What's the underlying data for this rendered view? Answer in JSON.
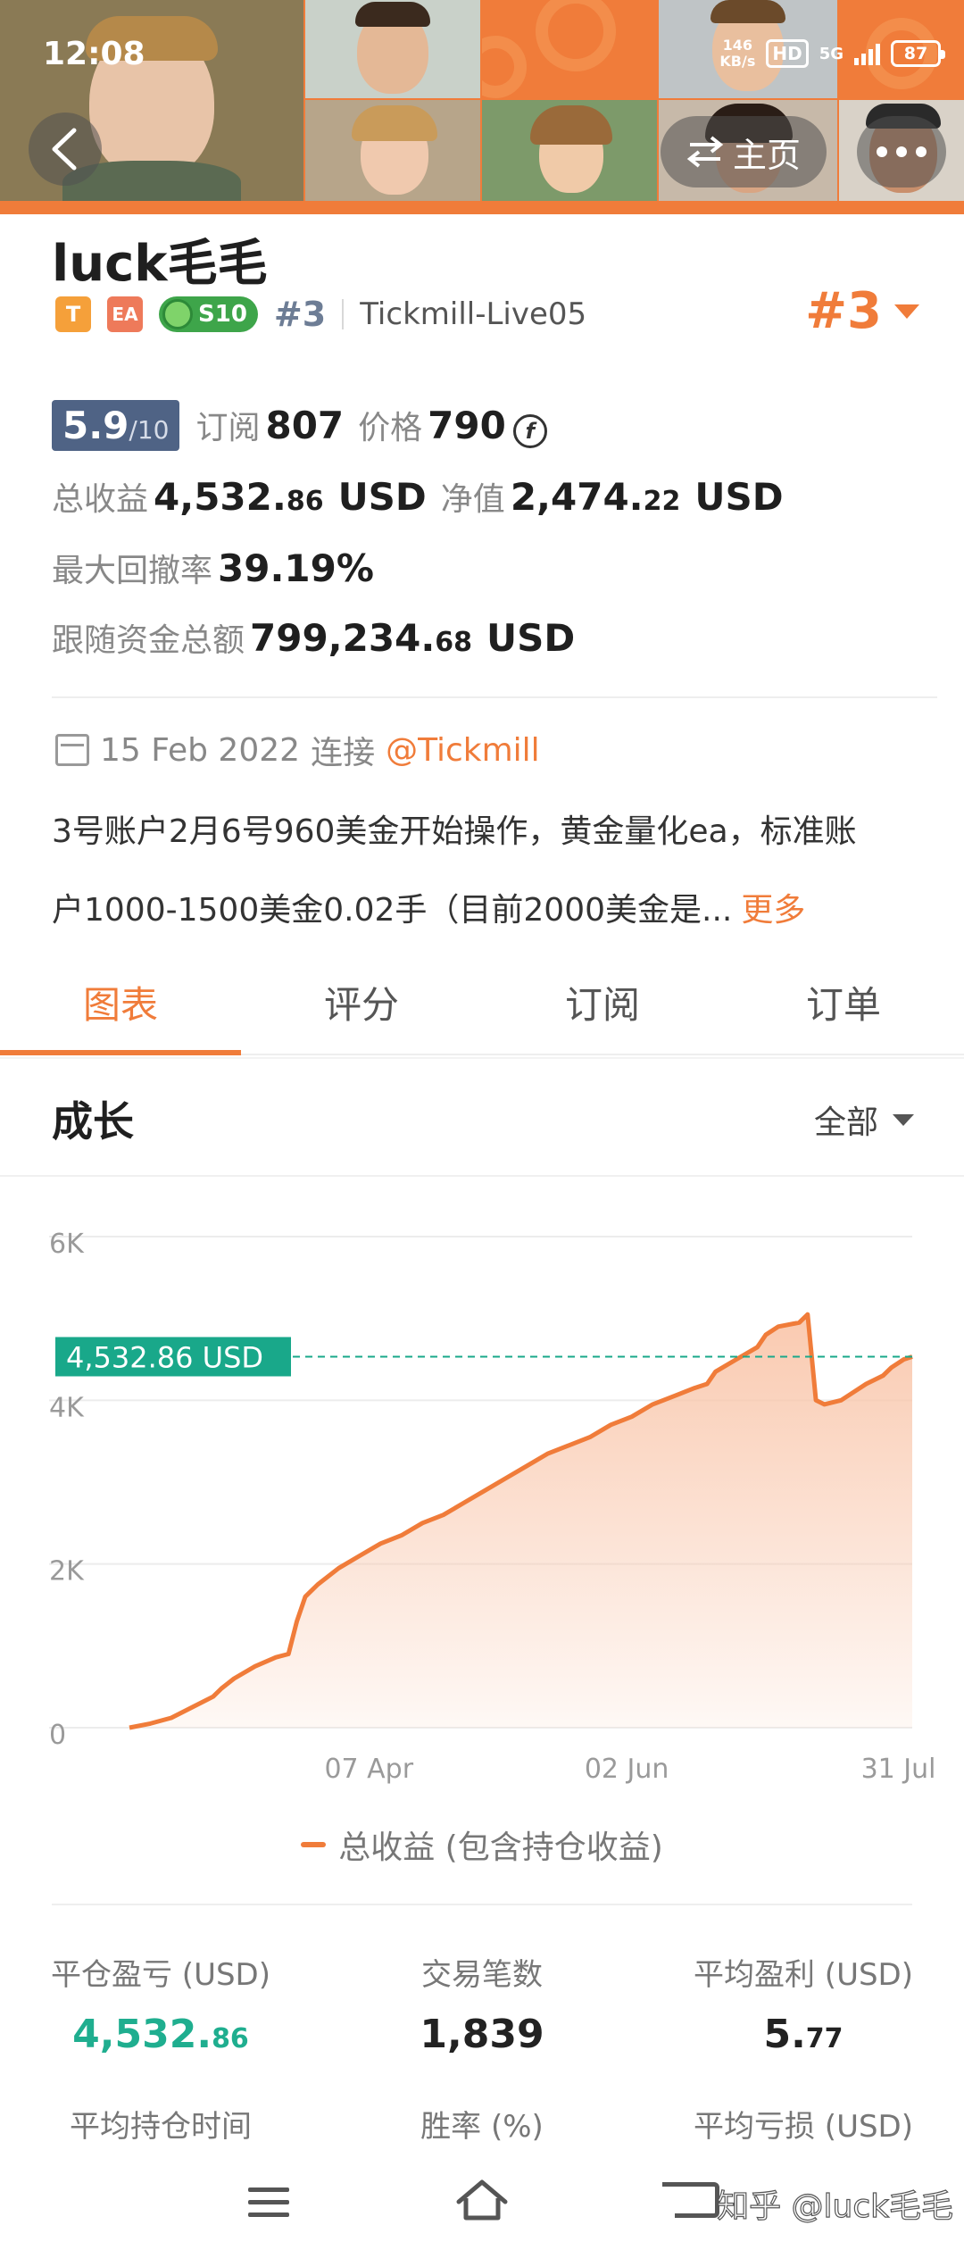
{
  "status_bar": {
    "time": "12:08",
    "net_speed_value": "146",
    "net_speed_unit": "KB/s",
    "hd": "HD",
    "network": "5G",
    "battery": "87"
  },
  "header": {
    "home_label": "主页",
    "home_icon": "swap-arrows-icon",
    "back_icon": "chevron-left-icon",
    "more_icon": "more-dots-icon",
    "brand_color": "#f07c3a"
  },
  "profile": {
    "name": "luck毛毛",
    "tag_t": "T",
    "tag_ea": "EA",
    "tag_season": "S10",
    "rank_small": "#3",
    "server": "Tickmill-Live05",
    "rank_big": "#3"
  },
  "stats": {
    "score": "5.9",
    "score_max": "/10",
    "subscribe_label": "订阅",
    "subscribe_value": "807",
    "price_label": "价格",
    "price_value": "790",
    "price_currency_icon": "f",
    "total_profit_label": "总收益",
    "total_profit_int": "4,532.",
    "total_profit_dec": "86",
    "total_profit_unit": "USD",
    "equity_label": "净值",
    "equity_int": "2,474.",
    "equity_dec": "22",
    "equity_unit": "USD",
    "max_drawdown_label": "最大回撤率",
    "max_drawdown_value": "39.19%",
    "follow_funds_label": "跟随资金总额",
    "follow_funds_int": "799,234.",
    "follow_funds_dec": "68",
    "follow_funds_unit": "USD"
  },
  "info": {
    "date": "15 Feb 2022",
    "connect_label": "连接",
    "broker": "@Tickmill",
    "description_line1": "3号账户2月6号960美金开始操作，黄金量化ea，标准账",
    "description_line2": "户1000-1500美金0.02手（目前2000美金是...",
    "more_label": "更多"
  },
  "tabs": [
    {
      "label": "图表",
      "active": true
    },
    {
      "label": "评分",
      "active": false
    },
    {
      "label": "订阅",
      "active": false
    },
    {
      "label": "订单",
      "active": false
    }
  ],
  "growth": {
    "title": "成长",
    "filter_label": "全部"
  },
  "chart_data": {
    "type": "area",
    "y_ticks": [
      "6K",
      "4K",
      "2K",
      "0"
    ],
    "ylim": [
      0,
      6000
    ],
    "x_ticks": [
      "07 Apr",
      "02 Jun",
      "31 Jul"
    ],
    "x_tick_positions": [
      52,
      108,
      167
    ],
    "xlim": [
      0,
      170
    ],
    "current_value": 4532.86,
    "current_label": "4,532.86 USD",
    "series": [
      {
        "name": "总收益 (包含持仓收益)",
        "color": "#f07c3a",
        "points": [
          [
            0,
            0
          ],
          [
            5,
            50
          ],
          [
            10,
            120
          ],
          [
            15,
            250
          ],
          [
            20,
            380
          ],
          [
            22,
            480
          ],
          [
            25,
            600
          ],
          [
            30,
            750
          ],
          [
            35,
            860
          ],
          [
            38,
            900
          ],
          [
            40,
            1300
          ],
          [
            42,
            1600
          ],
          [
            45,
            1750
          ],
          [
            50,
            1950
          ],
          [
            55,
            2100
          ],
          [
            60,
            2250
          ],
          [
            65,
            2350
          ],
          [
            70,
            2500
          ],
          [
            75,
            2600
          ],
          [
            80,
            2750
          ],
          [
            85,
            2900
          ],
          [
            90,
            3050
          ],
          [
            95,
            3200
          ],
          [
            100,
            3350
          ],
          [
            105,
            3450
          ],
          [
            110,
            3550
          ],
          [
            115,
            3700
          ],
          [
            120,
            3800
          ],
          [
            125,
            3950
          ],
          [
            130,
            4050
          ],
          [
            135,
            4150
          ],
          [
            138,
            4200
          ],
          [
            140,
            4350
          ],
          [
            145,
            4500
          ],
          [
            150,
            4650
          ],
          [
            152,
            4800
          ],
          [
            155,
            4900
          ],
          [
            160,
            4950
          ],
          [
            162,
            5050
          ],
          [
            164,
            4000
          ],
          [
            166,
            3950
          ],
          [
            170,
            4000
          ],
          [
            173,
            4100
          ],
          [
            176,
            4200
          ],
          [
            180,
            4300
          ],
          [
            182,
            4400
          ],
          [
            185,
            4500
          ],
          [
            187,
            4532.86
          ]
        ]
      }
    ],
    "legend": "总收益 (包含持仓收益)",
    "grid": true,
    "area_fill": "#f9c7ac",
    "marker_color": "#19a88a"
  },
  "summary": [
    {
      "label": "平仓盈亏 (USD)",
      "int": "4,532.",
      "dec": "86",
      "green": true
    },
    {
      "label": "交易笔数",
      "int": "1,839",
      "dec": "",
      "green": false
    },
    {
      "label": "平均盈利 (USD)",
      "int": "5.",
      "dec": "77",
      "green": false
    },
    {
      "label": "平均持仓时间"
    },
    {
      "label": "胜率 (%)"
    },
    {
      "label": "平均亏损 (USD)"
    }
  ],
  "navbar": {
    "menu_icon": "menu-icon",
    "home_icon": "home-icon",
    "back_icon": "back-icon",
    "watermark": "知乎 @luck毛毛"
  }
}
